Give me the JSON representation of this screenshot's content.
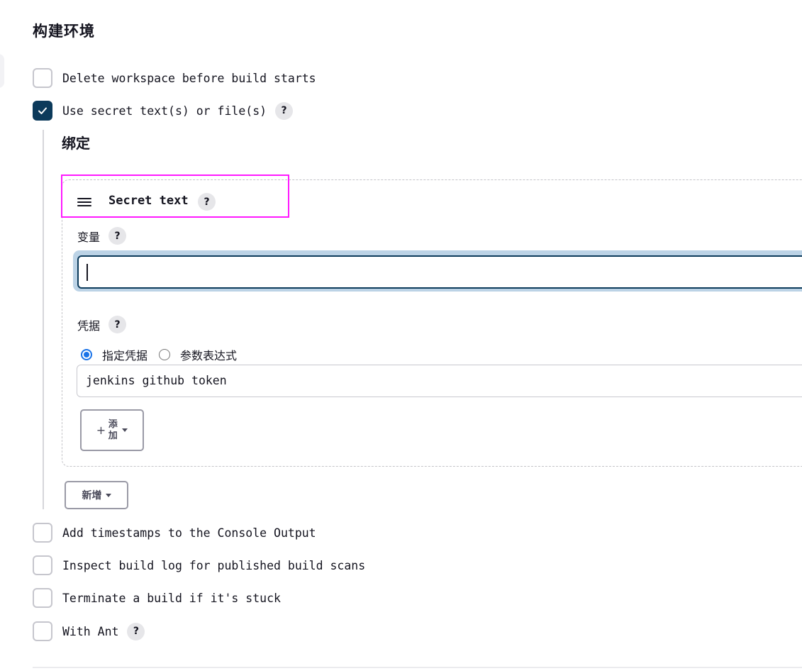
{
  "section": {
    "title": "构建环境"
  },
  "options": [
    {
      "label": "Delete workspace before build starts",
      "checked": false
    },
    {
      "label": "Use secret text(s) or file(s)",
      "checked": true
    },
    {
      "label": "Add timestamps to the Console Output",
      "checked": false
    },
    {
      "label": "Inspect build log for published build scans",
      "checked": false
    },
    {
      "label": "Terminate a build if it's stuck",
      "checked": false
    },
    {
      "label": "With Ant",
      "checked": false
    }
  ],
  "help_glyph": "?",
  "bindings": {
    "title": "绑定",
    "secret_text": {
      "title": "Secret text",
      "variable": {
        "label": "变量",
        "value": ""
      },
      "credentials": {
        "label": "凭据",
        "radio_specific": "指定凭据",
        "radio_expression": "参数表达式",
        "selected": "specific",
        "value": "jenkins github token"
      },
      "add_button": {
        "plus": "+",
        "label": "添加"
      }
    },
    "new_button": "新增"
  },
  "colors": {
    "checkbox_checked": "#0c3a5b",
    "highlight_border": "#ff19ff",
    "input_focus": "#0c3a5b",
    "radio_selected": "#1a73e8"
  },
  "icons": [
    "check-icon",
    "help-icon",
    "drag-handle-icon",
    "caret-down-icon"
  ]
}
